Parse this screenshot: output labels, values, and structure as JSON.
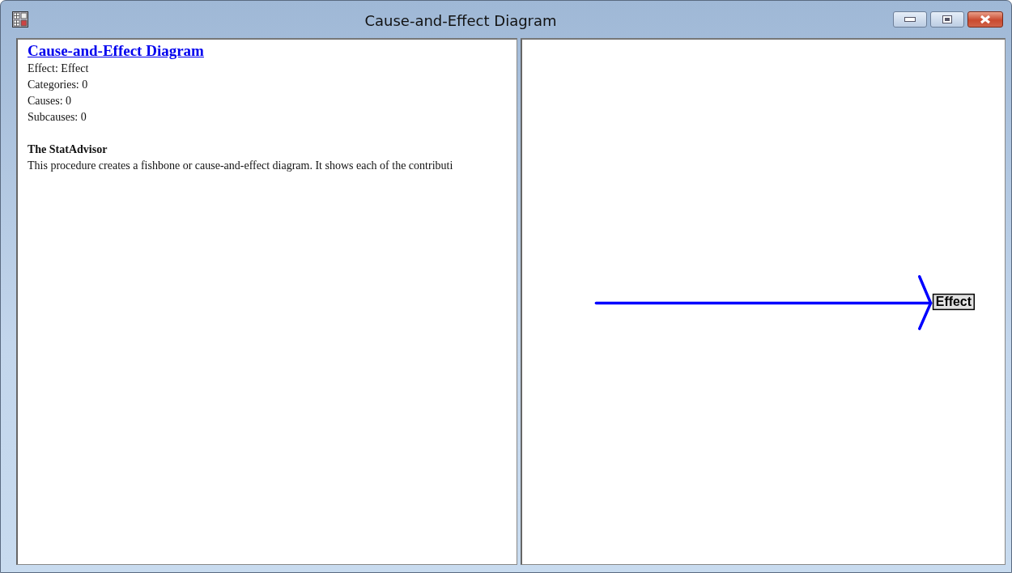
{
  "window": {
    "title": "Cause-and-Effect Diagram"
  },
  "report": {
    "heading": "Cause-and-Effect Diagram",
    "lines": [
      "Effect: Effect",
      "Categories: 0",
      "Causes: 0",
      "Subcauses: 0"
    ],
    "advisor_title": "The StatAdvisor",
    "advisor_text": "This procedure creates a fishbone or cause-and-effect diagram.  It shows each of the contributi"
  },
  "diagram": {
    "effect_label": "Effect"
  }
}
